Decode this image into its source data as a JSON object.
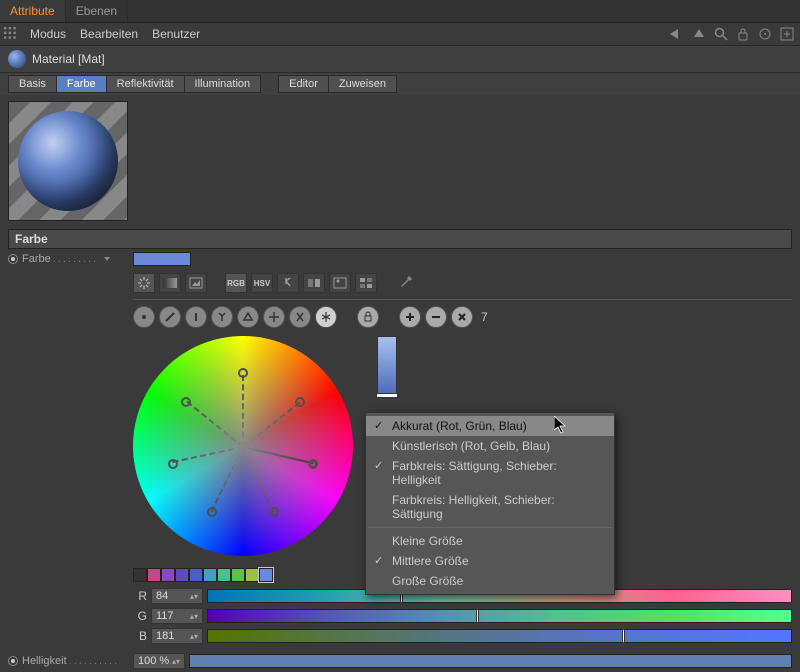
{
  "tabs": {
    "attribute": "Attribute",
    "ebenen": "Ebenen"
  },
  "menus": {
    "modus": "Modus",
    "bearbeiten": "Bearbeiten",
    "benutzer": "Benutzer"
  },
  "material_title": "Material [Mat]",
  "channels": {
    "basis": "Basis",
    "farbe": "Farbe",
    "reflektivitaet": "Reflektivität",
    "illumination": "Illumination",
    "editor": "Editor",
    "zuweisen": "Zuweisen"
  },
  "section": {
    "farbe": "Farbe"
  },
  "labels": {
    "farbe": "Farbe",
    "helligkeit": "Helligkeit"
  },
  "mode_badges": {
    "rgb": "RGB",
    "hsv": "HSV"
  },
  "zoom": "7",
  "rgb": {
    "r_value": "84",
    "g_value": "117",
    "b_value": "181",
    "r_label": "R",
    "g_label": "G",
    "b_label": "B"
  },
  "brightness_value": "100 %",
  "context_menu": {
    "akkurat": "Akkurat (Rot, Grün, Blau)",
    "kuenstlerisch": "Künstlerisch (Rot, Gelb, Blau)",
    "sat_helligkeit": "Farbkreis: Sättigung, Schieber: Helligkeit",
    "hell_saettigung": "Farbkreis: Helligkeit, Schieber: Sättigung",
    "kleine": "Kleine Größe",
    "mittlere": "Mittlere Größe",
    "grosse": "Große Größe"
  },
  "swatch_colors": [
    "#333",
    "#c04a85",
    "#8a4ac0",
    "#604ac0",
    "#4a60c0",
    "#4a9cc0",
    "#4ac08a",
    "#60c04a",
    "#9cc04a",
    "#6b8bd8"
  ],
  "dots": ".........",
  "dots_long": ".........."
}
